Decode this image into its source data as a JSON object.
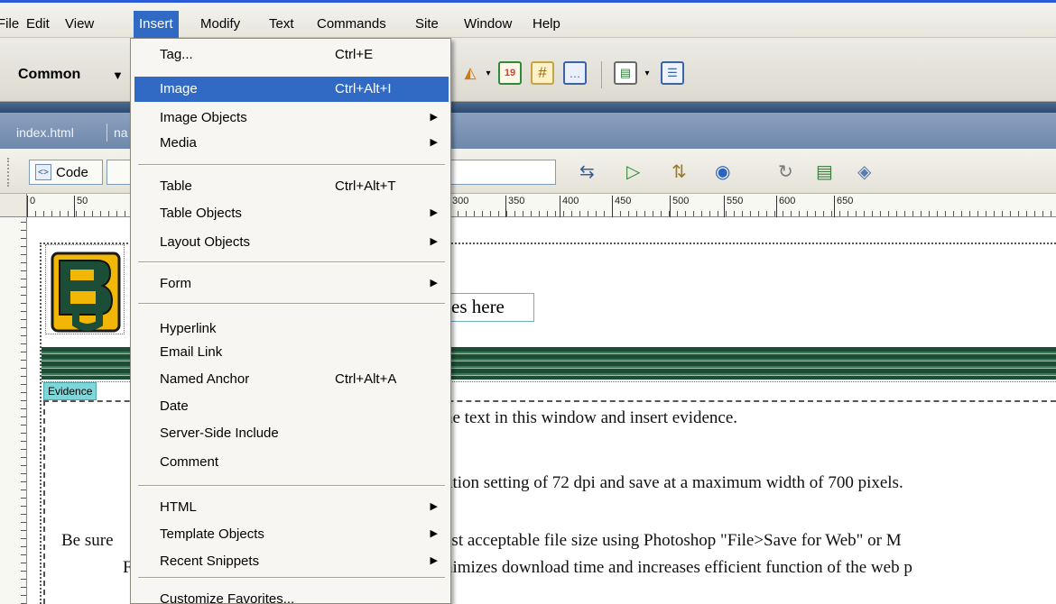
{
  "menubar": {
    "items": [
      "File",
      "Edit",
      "View",
      "Insert",
      "Modify",
      "Text",
      "Commands",
      "Site",
      "Window",
      "Help"
    ],
    "active": "Insert"
  },
  "insertbar": {
    "category": "Common",
    "icons": [
      "template-icon",
      "date-icon",
      "server-include-icon",
      "comment-icon",
      "templates-icon",
      "tag-chooser-icon"
    ]
  },
  "document_tabs": [
    "index.html",
    "na"
  ],
  "document_toolbar": {
    "code_label": "Code",
    "title_value": ""
  },
  "ruler": {
    "ticks": [
      "0",
      "50",
      "300",
      "350",
      "400",
      "450",
      "500",
      "550",
      "600",
      "650"
    ]
  },
  "page": {
    "logo_text": "BU",
    "header_text": "es here",
    "evidence_tag": "Evidence",
    "line1": "he text in this window and insert evidence.",
    "line2": "ution setting of 72 dpi and save at a maximum width of 700 pixels.",
    "line3_left": "Be sure",
    "line3_right": "est acceptable file size using Photoshop \"File>Save for Web\" or M",
    "line4_left": "F",
    "line4_right": "nimizes download time and increases efficient function of the web p"
  },
  "insert_menu": {
    "items": [
      {
        "label": "Tag...",
        "shortcut": "Ctrl+E",
        "submenu": false
      },
      {
        "label": "Image",
        "shortcut": "Ctrl+Alt+I",
        "submenu": false,
        "selected": true
      },
      {
        "label": "Image Objects",
        "shortcut": "",
        "submenu": true
      },
      {
        "label": "Media",
        "shortcut": "",
        "submenu": true
      },
      {
        "label": "Table",
        "shortcut": "Ctrl+Alt+T",
        "submenu": false
      },
      {
        "label": "Table Objects",
        "shortcut": "",
        "submenu": true
      },
      {
        "label": "Layout Objects",
        "shortcut": "",
        "submenu": true
      },
      {
        "label": "Form",
        "shortcut": "",
        "submenu": true
      },
      {
        "label": "Hyperlink",
        "shortcut": "",
        "submenu": false
      },
      {
        "label": "Email Link",
        "shortcut": "",
        "submenu": false
      },
      {
        "label": "Named Anchor",
        "shortcut": "Ctrl+Alt+A",
        "submenu": false
      },
      {
        "label": "Date",
        "shortcut": "",
        "submenu": false
      },
      {
        "label": "Server-Side Include",
        "shortcut": "",
        "submenu": false
      },
      {
        "label": "Comment",
        "shortcut": "",
        "submenu": false
      },
      {
        "label": "HTML",
        "shortcut": "",
        "submenu": true
      },
      {
        "label": "Template Objects",
        "shortcut": "",
        "submenu": true
      },
      {
        "label": "Recent Snippets",
        "shortcut": "",
        "submenu": true
      },
      {
        "label": "Customize Favorites...",
        "shortcut": "",
        "submenu": false
      }
    ]
  },
  "colors": {
    "menu_highlight": "#316ac5",
    "baylor_green": "#1c4d36",
    "baylor_gold": "#f2b705",
    "evidence_tag": "#7fd6d8"
  }
}
